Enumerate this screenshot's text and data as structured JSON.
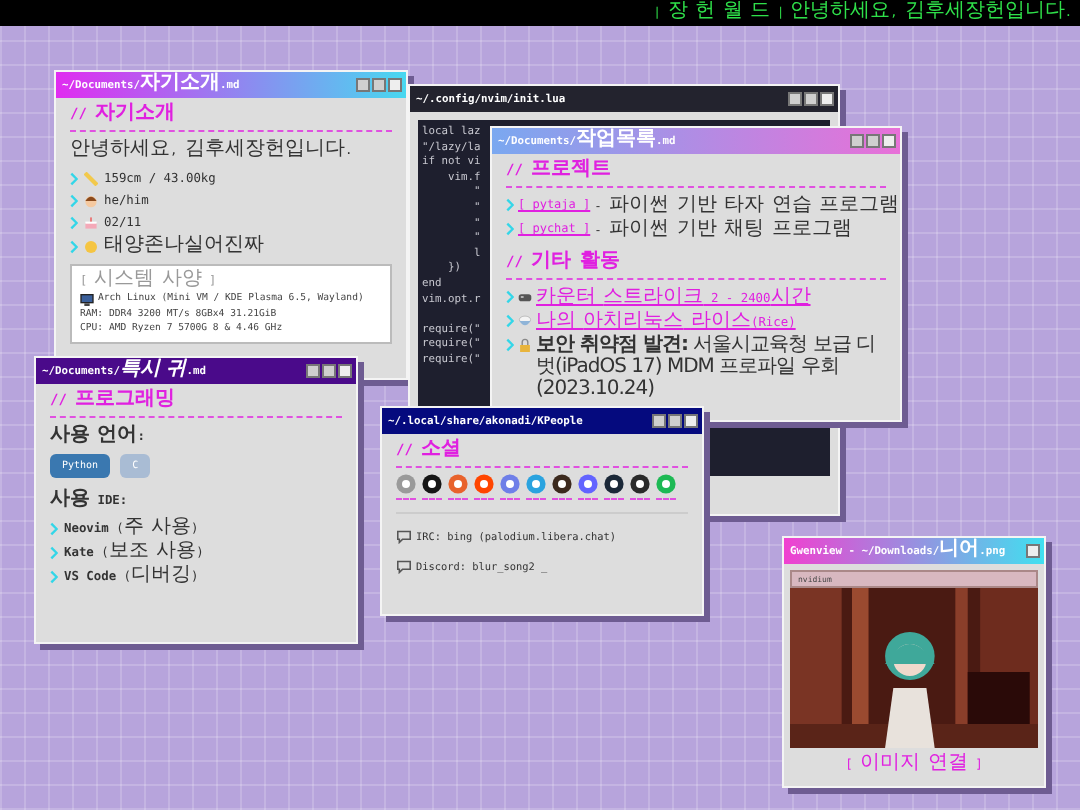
{
  "top_bar": {
    "brand": "| 장 헌 월 드 |",
    "greeting": "안녕하세요, 김후세장헌입니다."
  },
  "intro_window": {
    "title": "~/Documents/자기소개.md",
    "heading": "// 자기소개",
    "greeting": "안녕하세요, 김후세장헌입니다.",
    "facts": [
      {
        "kind": "ruler",
        "text": "159cm / 43.00kg"
      },
      {
        "kind": "head",
        "text": "he/him"
      },
      {
        "kind": "cake",
        "text": "02/11"
      },
      {
        "kind": "sun",
        "text": "태양존나실어진짜"
      }
    ],
    "system": {
      "heading": "[ 시스템 사양 ]",
      "lines": [
        "Arch Linux (Mini VM / KDE Plasma 6.5, Wayland)",
        "RAM: DDR4 3200 MT/s 8GBx4 31.21GiB",
        "CPU: AMD Ryzen 7 5700G 8 & 4.46 GHz"
      ]
    }
  },
  "code_window": {
    "title": "~/.config/nvim/init.lua",
    "lines": [
      "local laz",
      "\"/lazy/la",
      "if not vi",
      "    vim.f",
      "        \"",
      "        \"",
      "        \"",
      "        \"",
      "        l",
      "    })",
      "end",
      "vim.opt.r",
      "require(\"",
      "require(\"",
      "require(\""
    ]
  },
  "tasks_window": {
    "title": "~/Documents/작업목록.md",
    "sections": [
      {
        "heading": "// 프로젝트",
        "items": [
          {
            "kind": "project",
            "link": "[ pytaja ]",
            "text": "- 파이썬 기반 타자 연습 프로그램"
          },
          {
            "kind": "project",
            "link": "[ pychat ]",
            "text": "- 파이썬 기반 채팅 프로그램"
          }
        ]
      },
      {
        "heading": "// 기타 활동",
        "items": [
          {
            "kind": "game",
            "link": "카운터 스트라이크 2 - 2400시간"
          },
          {
            "kind": "bowl",
            "link": "나의 아치리눅스 라이스(Rice)"
          },
          {
            "kind": "lock",
            "text": "**보안 취약점 발견:** 서울시교육청 보급 디벗(iPadOS 17) MDM 프로파일 우회 (2023.10.24)"
          }
        ]
      }
    ]
  },
  "programming_window": {
    "title": "~/Documents/*특시 귀*.md",
    "heading": "// 프로그래밍",
    "languages_label": "사용 언어:",
    "languages": [
      {
        "label": "Python",
        "color": "#3a78b0"
      },
      {
        "label": "C",
        "color": "#a9bcd4"
      }
    ],
    "ide_label": "사용 IDE:",
    "ides": [
      "**Neovim** (주 사용)",
      "**Kate** (보조 사용)",
      "**VS Code** (디버깅)"
    ]
  },
  "social_window": {
    "title": "~/.local/share/akonadi/KPeople",
    "heading": "// 소셜",
    "icons": [
      {
        "color": "#9a9a9a"
      },
      {
        "color": "#161616"
      },
      {
        "color": "#e8622c"
      },
      {
        "color": "#ff4500"
      },
      {
        "color": "#6f7fe8"
      },
      {
        "color": "#2aa3df"
      },
      {
        "color": "#3c2a1e"
      },
      {
        "color": "#6364ff"
      },
      {
        "color": "#1b2838"
      },
      {
        "color": "#2a2a2a"
      },
      {
        "color": "#1db954"
      }
    ],
    "contacts": [
      "IRC: bing (palodium.libera.chat)",
      "Discord: blur_song2 _"
    ]
  },
  "viewer_window": {
    "title": "Gwenview - ~/Downloads/니어.png",
    "inner_title": "nvidium",
    "caption": "[ 이미지 연결 ]"
  }
}
